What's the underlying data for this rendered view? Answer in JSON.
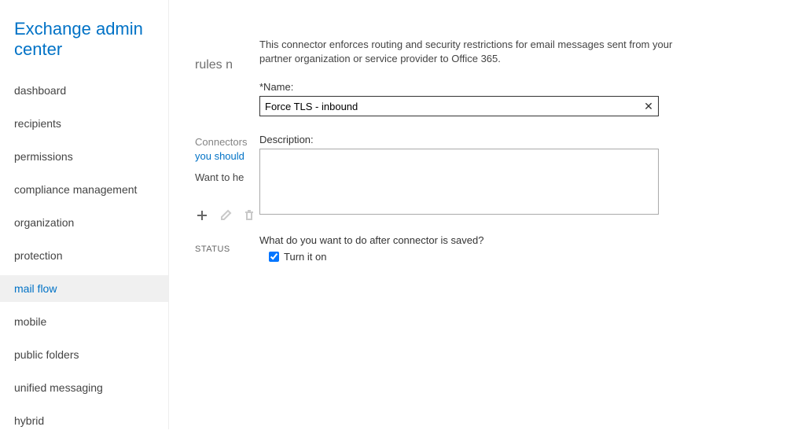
{
  "brand": "Exchange admin center",
  "nav": {
    "items": [
      {
        "label": "dashboard",
        "active": false
      },
      {
        "label": "recipients",
        "active": false
      },
      {
        "label": "permissions",
        "active": false
      },
      {
        "label": "compliance management",
        "active": false
      },
      {
        "label": "organization",
        "active": false
      },
      {
        "label": "protection",
        "active": false
      },
      {
        "label": "mail flow",
        "active": true
      },
      {
        "label": "mobile",
        "active": false
      },
      {
        "label": "public folders",
        "active": false
      },
      {
        "label": "unified messaging",
        "active": false
      },
      {
        "label": "hybrid",
        "active": false
      }
    ]
  },
  "mid": {
    "tabs": "rules    n",
    "connectors_word": "Connectors",
    "you_should": "you should",
    "want_to": "Want to he",
    "status": "STATUS"
  },
  "panel": {
    "intro": "This connector enforces routing and security restrictions for email messages sent from your partner organization or service provider to Office 365.",
    "name_label": "*Name:",
    "name_value": "Force TLS - inbound",
    "desc_label": "Description:",
    "desc_value": "",
    "after_saved_q": "What do you want to do after connector is saved?",
    "turn_on_label": "Turn it on",
    "turn_on_checked": true
  }
}
